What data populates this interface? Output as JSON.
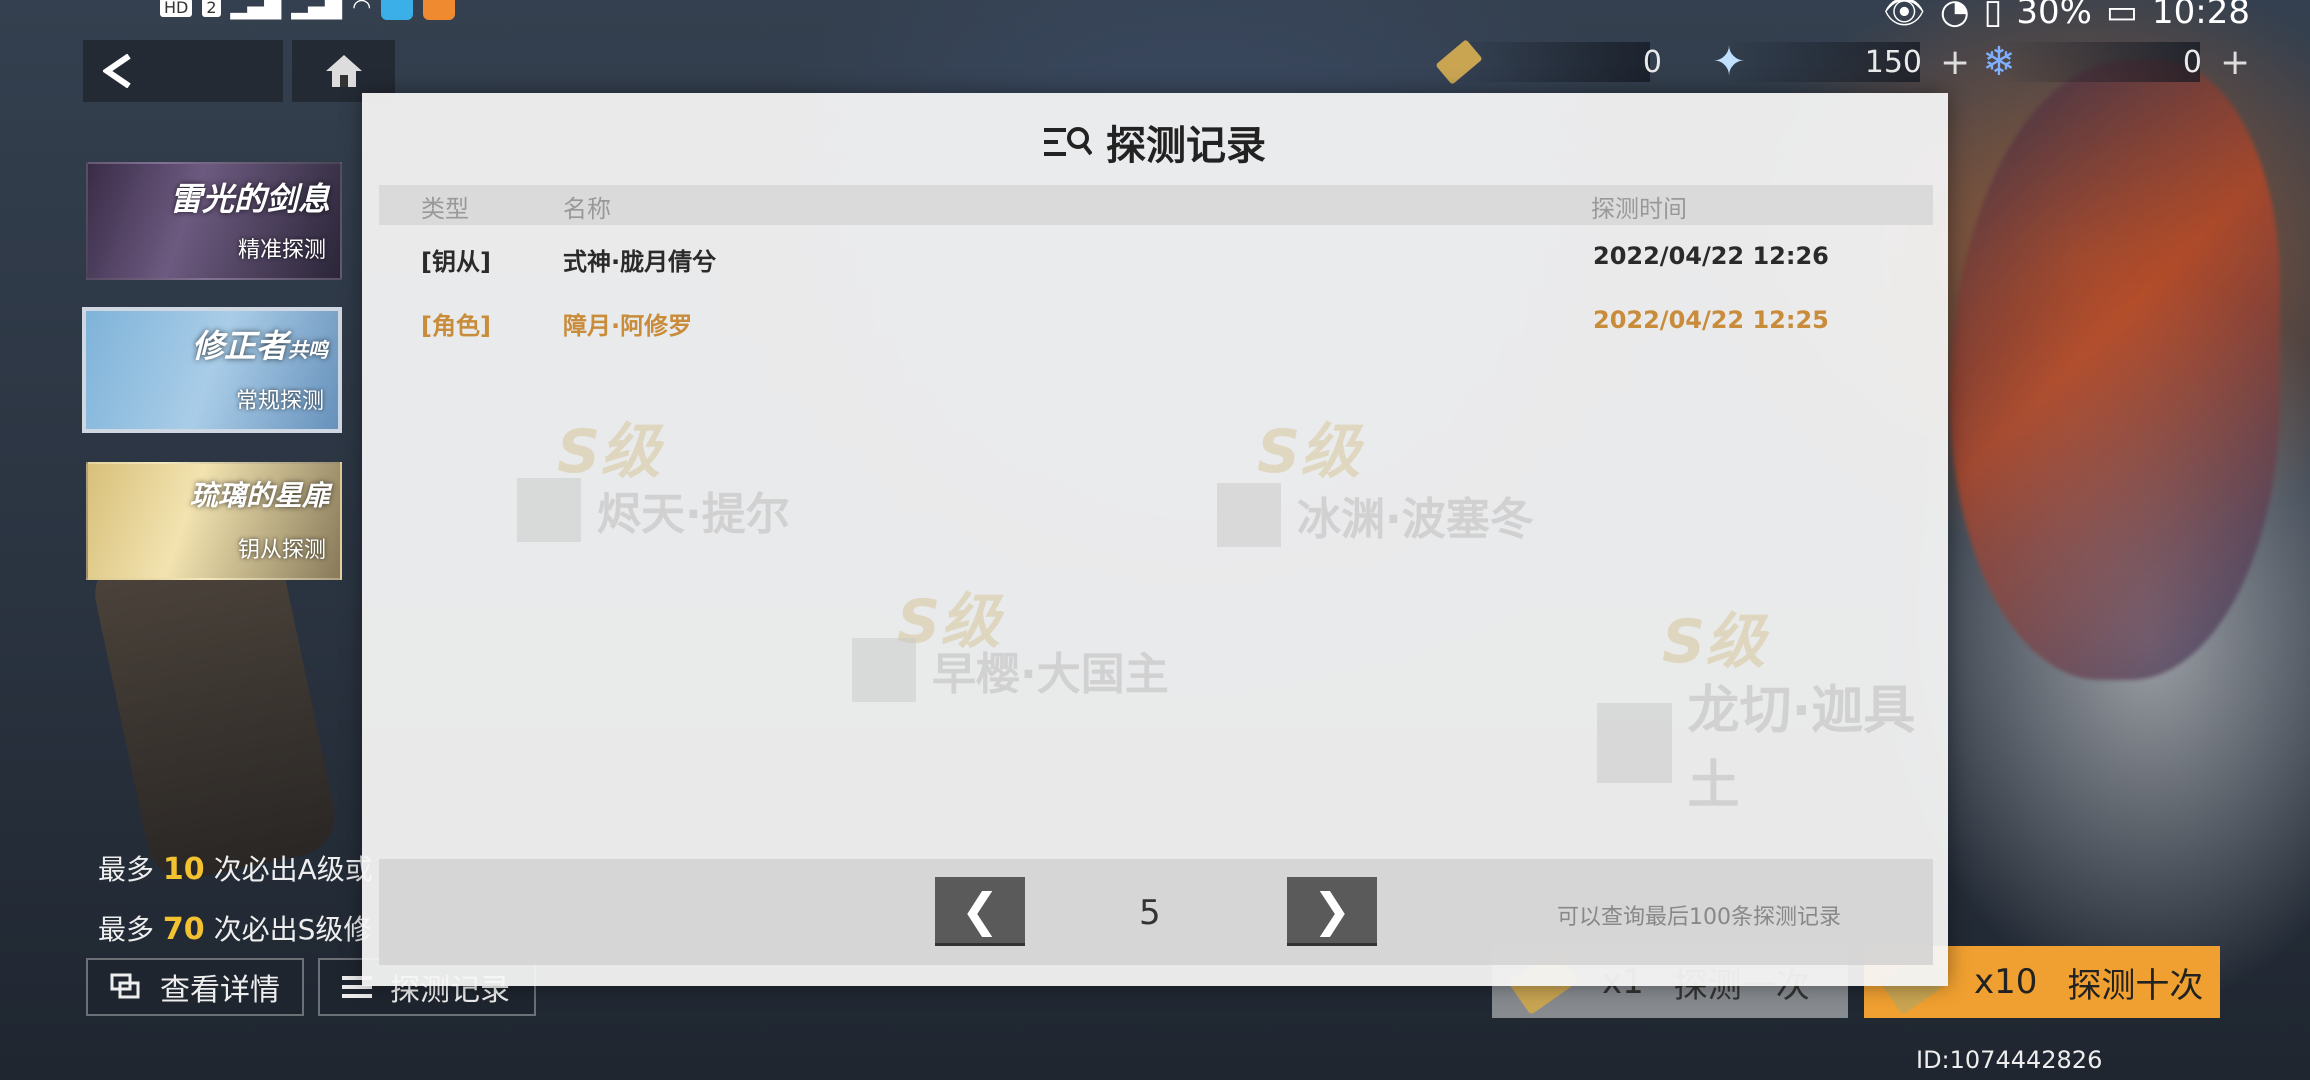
{
  "status_bar": {
    "left_chip": "HD",
    "left_chip_2": "2",
    "battery": "30%",
    "time": "10:28"
  },
  "nav": {
    "back_icon": "back-arrow-icon",
    "home_icon": "home-icon"
  },
  "currency": [
    {
      "icon": "ticket-icon",
      "value": "0",
      "plus": false
    },
    {
      "icon": "crystal-star-icon",
      "value": "150",
      "plus": true,
      "plus_label": "+"
    },
    {
      "icon": "blue-flake-icon",
      "value": "0",
      "plus": true,
      "plus_label": "+"
    }
  ],
  "banners": [
    {
      "title": "雷光的剑息",
      "subtitle": "精准探测"
    },
    {
      "title": "修正者",
      "title_suffix": "共鸣",
      "subtitle": "常规探测"
    },
    {
      "title": "琉璃的星扉",
      "subtitle": "钥从探测"
    }
  ],
  "guarantee": {
    "line1_prefix": "最多",
    "line1_num": "10",
    "line1_suffix": "次必出A级或",
    "line2_prefix": "最多",
    "line2_num": "70",
    "line2_suffix": "次必出S级修"
  },
  "bottom_left_buttons": {
    "details": "查看详情",
    "records": "探测记录"
  },
  "pull": {
    "single_count": "x1",
    "single_label": "探测一次",
    "ten_count": "x10",
    "ten_label": "探测十次"
  },
  "uid": "ID:1074442826",
  "modal": {
    "title": "探测记录",
    "headers": {
      "type": "类型",
      "name": "名称",
      "time": "探测时间"
    },
    "rows": [
      {
        "type": "[钥从]",
        "name": "式神·胧月倩兮",
        "time": "2022/04/22 12:26"
      },
      {
        "type": "[角色]",
        "name": "障月·阿修罗",
        "time": "2022/04/22 12:25"
      }
    ],
    "watermarks": [
      "烬天·提尔",
      "冰渊·波塞冬",
      "早樱·大国主",
      "龙切·迦具土"
    ],
    "watermark_level": "S级",
    "pager": {
      "prev": "❮",
      "page": "5",
      "next": "❯",
      "note": "可以查询最后100条探测记录"
    }
  },
  "colors": {
    "accent_orange": "#f0a030",
    "highlight_row": "#c88c3a",
    "guarantee_num": "#f2c230"
  }
}
